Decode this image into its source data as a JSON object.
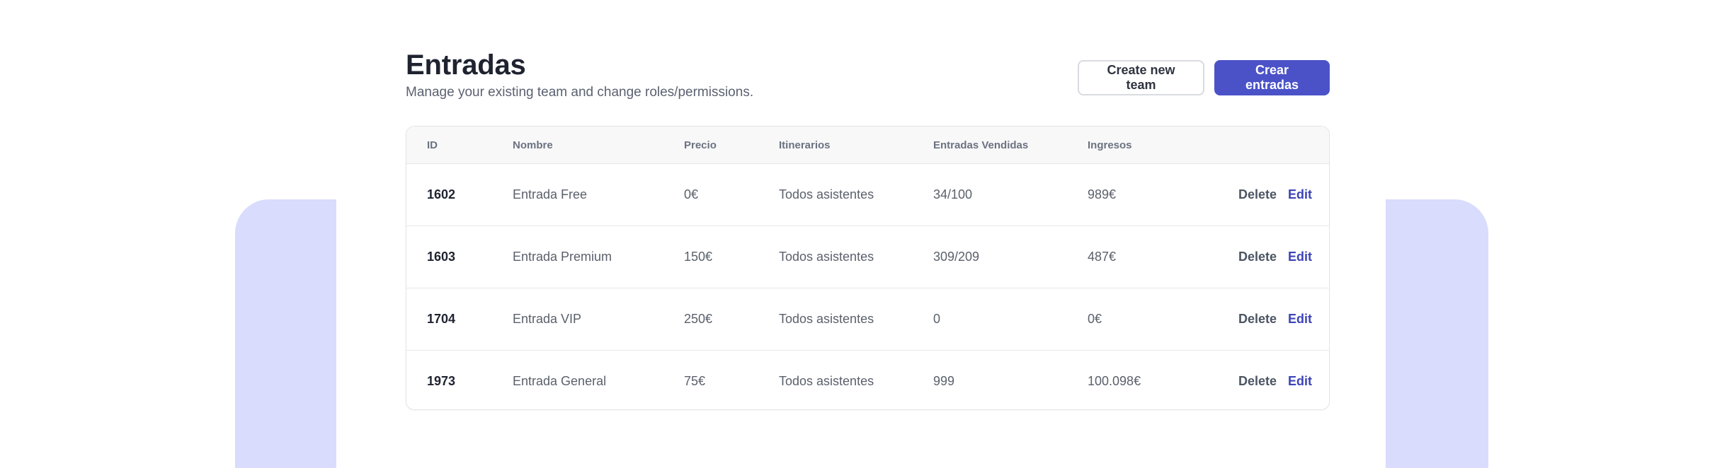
{
  "page": {
    "title": "Entradas",
    "subtitle": "Manage your existing team and change roles/permissions."
  },
  "actions": {
    "create_team_label": "Create new team",
    "create_entries_label": "Crear entradas"
  },
  "table": {
    "columns": [
      "ID",
      "Nombre",
      "Precio",
      "Itinerarios",
      "Entradas Vendidas",
      "Ingresos"
    ],
    "rows": [
      {
        "id": "1602",
        "nombre": "Entrada Free",
        "precio": "0€",
        "itinerarios": "Todos asistentes",
        "vendidas": "34/100",
        "ingresos": "989€",
        "delete_label": "Delete",
        "edit_label": "Edit"
      },
      {
        "id": "1603",
        "nombre": "Entrada Premium",
        "precio": "150€",
        "itinerarios": "Todos asistentes",
        "vendidas": "309/209",
        "ingresos": "487€",
        "delete_label": "Delete",
        "edit_label": "Edit"
      },
      {
        "id": "1704",
        "nombre": "Entrada VIP",
        "precio": "250€",
        "itinerarios": "Todos asistentes",
        "vendidas": "0",
        "ingresos": "0€",
        "delete_label": "Delete",
        "edit_label": "Edit"
      },
      {
        "id": "1973",
        "nombre": "Entrada General",
        "precio": "75€",
        "itinerarios": "Todos asistentes",
        "vendidas": "999",
        "ingresos": "100.098€",
        "delete_label": "Delete",
        "edit_label": "Edit"
      }
    ]
  },
  "colors": {
    "accent": "#4b52c8",
    "background_shape": "#d9dcfc",
    "edit_link": "#3d44b8"
  }
}
